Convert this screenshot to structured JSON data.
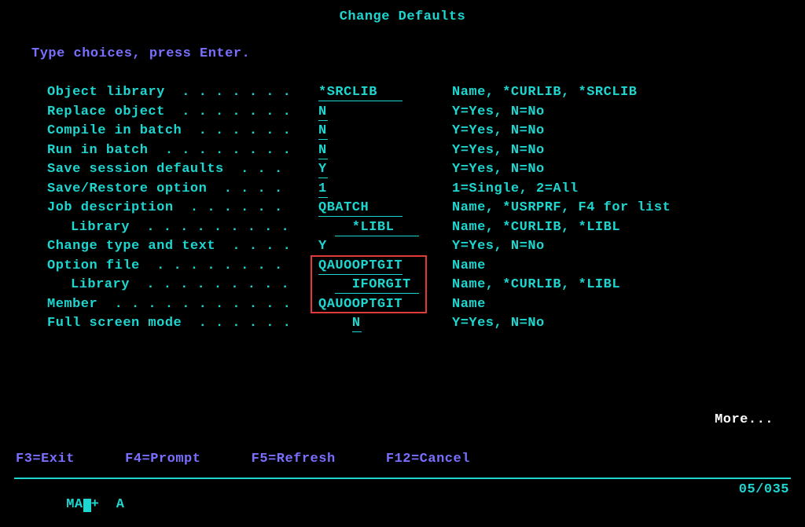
{
  "title": "Change Defaults",
  "instruction": "Type choices, press Enter.",
  "fields": {
    "object_library": {
      "label": "Object library  . . . . . . .",
      "value": "*SRCLIB   ",
      "hint": "Name, *CURLIB, *SRCLIB"
    },
    "replace_object": {
      "label": "Replace object  . . . . . . .",
      "value": "N",
      "hint": "Y=Yes, N=No"
    },
    "compile_in_batch": {
      "label": "Compile in batch  . . . . . .",
      "value": "N",
      "hint": "Y=Yes, N=No"
    },
    "run_in_batch": {
      "label": "Run in batch  . . . . . . . .",
      "value": "N",
      "hint": "Y=Yes, N=No"
    },
    "save_session": {
      "label": "Save session defaults  . . .",
      "value": "Y",
      "hint": "Y=Yes, N=No"
    },
    "save_restore_option": {
      "label": "Save/Restore option  . . . .",
      "value": "1",
      "hint": "1=Single, 2=All"
    },
    "job_description": {
      "label": "Job description  . . . . . .",
      "value": "QBATCH    ",
      "hint": "Name, *USRPRF, F4 for list"
    },
    "jd_library": {
      "label": "Library  . . . . . . . . .",
      "value": "  *LIBL   ",
      "hint": "Name, *CURLIB, *LIBL"
    },
    "change_type_text": {
      "label": "Change type and text  . . . .",
      "value": "Y",
      "hint": "Y=Yes, N=No"
    },
    "option_file": {
      "label": "Option file  . . . . . . . .",
      "value": "QAUOOPTGIT",
      "hint": "Name"
    },
    "of_library": {
      "label": "Library  . . . . . . . . .",
      "value": "  IFORGIT ",
      "hint": "Name, *CURLIB, *LIBL"
    },
    "member": {
      "label": "Member  . . . . . . . . . . .",
      "value": "QAUOOPTGIT",
      "hint": "Name"
    },
    "full_screen_mode": {
      "label": "Full screen mode  . . . . . .",
      "value": "N",
      "hint": "Y=Yes, N=No"
    }
  },
  "more": "More...",
  "fkeys": "F3=Exit      F4=Prompt      F5=Refresh      F12=Cancel",
  "status": {
    "left_pre": "MA",
    "left_post": "+  A",
    "pos": "05/035"
  }
}
